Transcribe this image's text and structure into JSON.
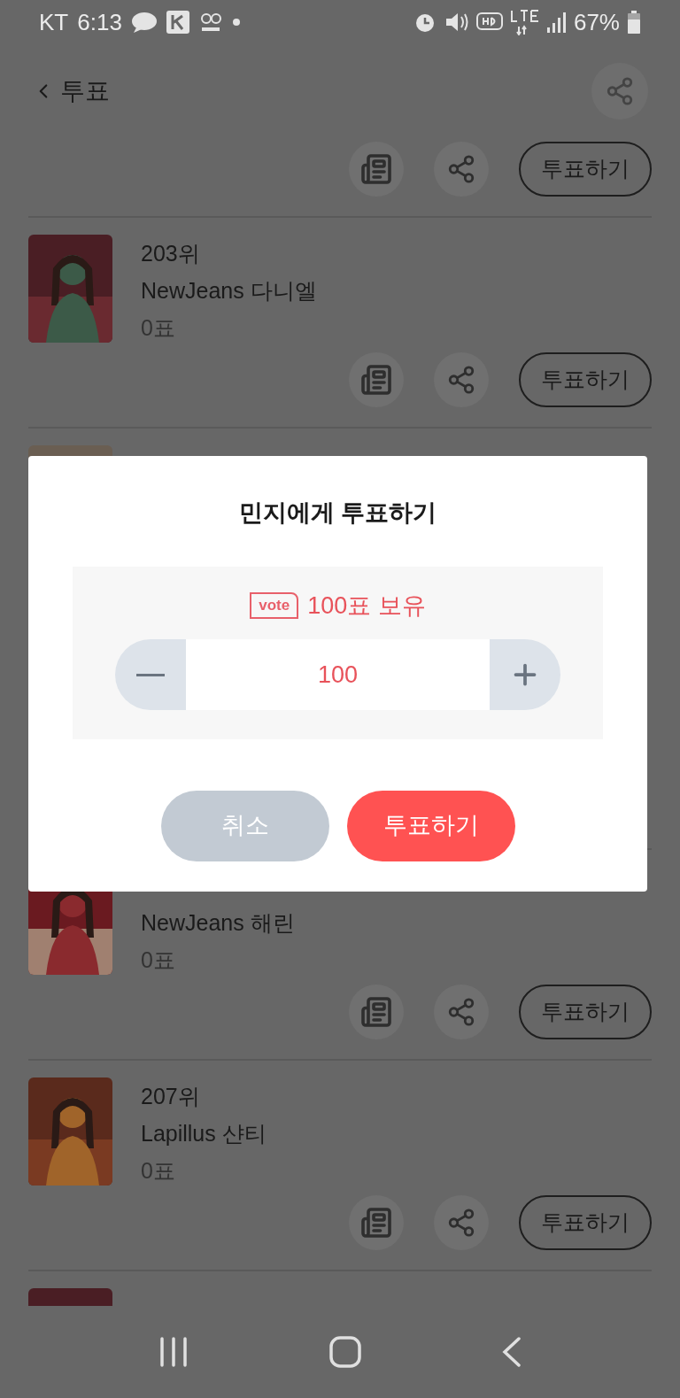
{
  "status_bar": {
    "carrier": "KT",
    "time": "6:13",
    "battery": "67%"
  },
  "header": {
    "title": "투표"
  },
  "rows": [
    {
      "kind": "actions",
      "vote_button": "투표하기"
    },
    {
      "kind": "full",
      "rank": "203위",
      "name": "NewJeans 다니엘",
      "votes": "0표",
      "vote_button": "투표하기"
    },
    {
      "kind": "covered"
    },
    {
      "kind": "full",
      "name": "NewJeans 해린",
      "votes": "0표",
      "vote_button": "투표하기"
    },
    {
      "kind": "full",
      "rank": "207위",
      "name": "Lapillus 샨티",
      "votes": "0표",
      "vote_button": "투표하기"
    },
    {
      "kind": "cut"
    }
  ],
  "dialog": {
    "title": "민지에게 투표하기",
    "vote_badge": "vote",
    "balance": "100표 보유",
    "amount": "100",
    "buttons": [
      {
        "kind": "cancel",
        "label": "취소"
      },
      {
        "kind": "confirm",
        "label": "투표하기"
      }
    ]
  }
}
